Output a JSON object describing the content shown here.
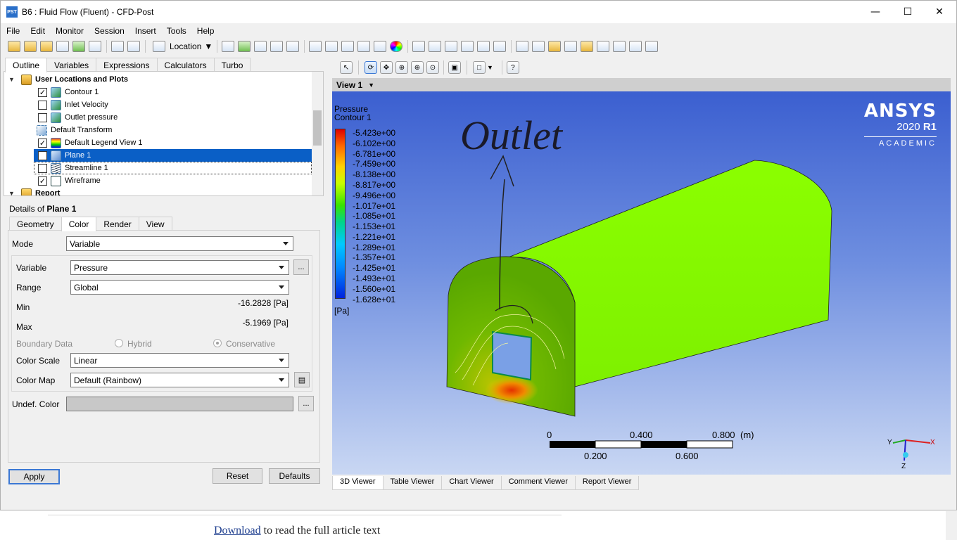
{
  "window": {
    "title": "B6 : Fluid Flow (Fluent) - CFD-Post",
    "icon_text": "PST",
    "minimize": "—",
    "maximize": "☐",
    "close": "✕"
  },
  "menu": [
    "File",
    "Edit",
    "Monitor",
    "Session",
    "Insert",
    "Tools",
    "Help"
  ],
  "toolbar": {
    "location_label": "Location"
  },
  "outline_tabs": [
    "Outline",
    "Variables",
    "Expressions",
    "Calculators",
    "Turbo"
  ],
  "tree": {
    "root": "User Locations and Plots",
    "items": [
      {
        "label": "Contour 1",
        "checked": true
      },
      {
        "label": "Inlet Velocity",
        "checked": false
      },
      {
        "label": "Outlet pressure",
        "checked": false
      },
      {
        "label": "Default Transform"
      },
      {
        "label": "Default Legend View 1",
        "checked": true
      },
      {
        "label": "Plane 1",
        "checked": false,
        "selected": true
      },
      {
        "label": "Streamline 1",
        "checked": false
      },
      {
        "label": "Wireframe",
        "checked": true
      }
    ],
    "report": "Report"
  },
  "details": {
    "prefix": "Details of ",
    "object": "Plane 1"
  },
  "detail_tabs": [
    "Geometry",
    "Color",
    "Render",
    "View"
  ],
  "form": {
    "mode_label": "Mode",
    "mode_value": "Variable",
    "variable_label": "Variable",
    "variable_value": "Pressure",
    "range_label": "Range",
    "range_value": "Global",
    "min_label": "Min",
    "min_value": "-16.2828 [Pa]",
    "max_label": "Max",
    "max_value": "-5.1969 [Pa]",
    "boundary_label": "Boundary Data",
    "hybrid": "Hybrid",
    "conservative": "Conservative",
    "colorscale_label": "Color Scale",
    "colorscale_value": "Linear",
    "colormap_label": "Color Map",
    "colormap_value": "Default (Rainbow)",
    "undef_label": "Undef. Color",
    "ellipsis": "..."
  },
  "buttons": {
    "apply": "Apply",
    "reset": "Reset",
    "defaults": "Defaults"
  },
  "view": {
    "name": "View 1",
    "legend_title1": "Pressure",
    "legend_title2": "Contour 1",
    "legend_unit": "[Pa]",
    "legend_ticks": [
      "-5.423e+00",
      "-6.102e+00",
      "-6.781e+00",
      "-7.459e+00",
      "-8.138e+00",
      "-8.817e+00",
      "-9.496e+00",
      "-1.017e+01",
      "-1.085e+01",
      "-1.153e+01",
      "-1.221e+01",
      "-1.289e+01",
      "-1.357e+01",
      "-1.425e+01",
      "-1.493e+01",
      "-1.560e+01",
      "-1.628e+01"
    ],
    "logo1": "ANSYS",
    "logo2a": "2020 ",
    "logo2b": "R1",
    "logo3": "ACADEMIC",
    "annotation": "Outlet",
    "scale_top": [
      "0",
      "0.400",
      "0.800"
    ],
    "scale_unit": "(m)",
    "scale_bottom": [
      "0.200",
      "0.600"
    ],
    "axes": {
      "y": "Y",
      "x": "X",
      "z": "Z"
    }
  },
  "viewer_tabs": [
    "3D Viewer",
    "Table Viewer",
    "Chart Viewer",
    "Comment Viewer",
    "Report Viewer"
  ],
  "footer": {
    "link": "Download",
    "text": " to read the full article text"
  }
}
